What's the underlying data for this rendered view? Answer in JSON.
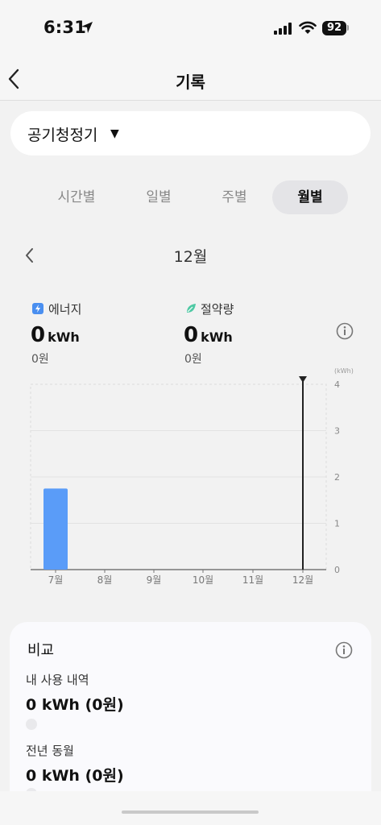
{
  "status": {
    "time": "6:31",
    "battery": "92"
  },
  "header": {
    "title": "기록"
  },
  "device": {
    "name": "공기청정기"
  },
  "tabs": [
    {
      "label": "시간별",
      "active": false
    },
    {
      "label": "일별",
      "active": false
    },
    {
      "label": "주별",
      "active": false
    },
    {
      "label": "월별",
      "active": true
    }
  ],
  "period": {
    "label": "12월"
  },
  "energy": {
    "label": "에너지",
    "value": "0",
    "unit": "kWh",
    "cost": "0원"
  },
  "savings": {
    "label": "절약량",
    "value": "0",
    "unit": "kWh",
    "cost": "0원"
  },
  "chart_data": {
    "type": "bar",
    "categories": [
      "7월",
      "8월",
      "9월",
      "10월",
      "11월",
      "12월"
    ],
    "values": [
      1.75,
      0,
      0,
      0,
      0,
      0
    ],
    "ylabel": "(kWh)",
    "ylim": [
      0,
      4
    ],
    "yticks": [
      "0",
      "1",
      "2",
      "3",
      "4"
    ],
    "selected": "12월",
    "bar_color": "#5a9cf8",
    "grid": true
  },
  "compare": {
    "title": "비교",
    "my_usage": {
      "label": "내 사용 내역",
      "value": "0 kWh (0원)"
    },
    "last_year": {
      "label": "전년 동월",
      "value": "0 kWh (0원)"
    }
  },
  "colors": {
    "accent": "#5a9cf8",
    "leaf": "#4fc9a4",
    "bolt": "#4a8ff0"
  }
}
